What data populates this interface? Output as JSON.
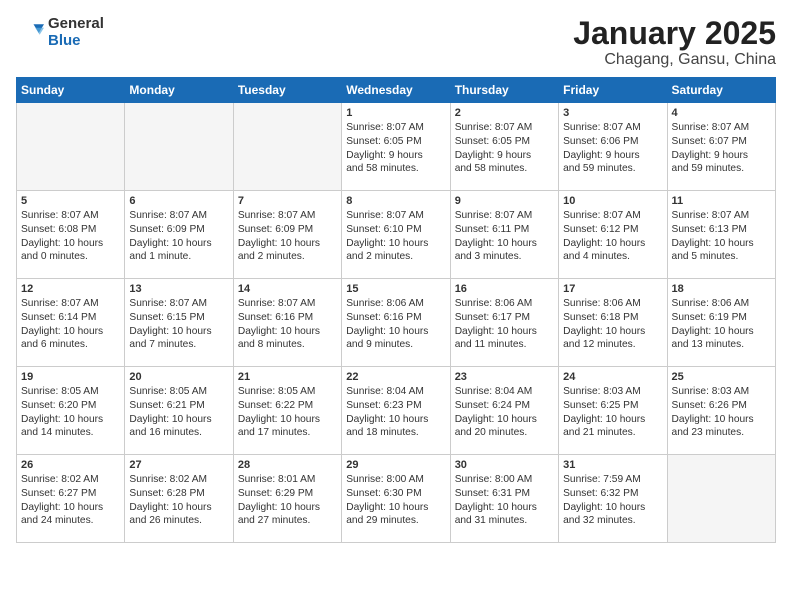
{
  "header": {
    "logo_general": "General",
    "logo_blue": "Blue",
    "title": "January 2025",
    "subtitle": "Chagang, Gansu, China"
  },
  "weekdays": [
    "Sunday",
    "Monday",
    "Tuesday",
    "Wednesday",
    "Thursday",
    "Friday",
    "Saturday"
  ],
  "weeks": [
    [
      {
        "day": "",
        "info": ""
      },
      {
        "day": "",
        "info": ""
      },
      {
        "day": "",
        "info": ""
      },
      {
        "day": "1",
        "info": "Sunrise: 8:07 AM\nSunset: 6:05 PM\nDaylight: 9 hours\nand 58 minutes."
      },
      {
        "day": "2",
        "info": "Sunrise: 8:07 AM\nSunset: 6:05 PM\nDaylight: 9 hours\nand 58 minutes."
      },
      {
        "day": "3",
        "info": "Sunrise: 8:07 AM\nSunset: 6:06 PM\nDaylight: 9 hours\nand 59 minutes."
      },
      {
        "day": "4",
        "info": "Sunrise: 8:07 AM\nSunset: 6:07 PM\nDaylight: 9 hours\nand 59 minutes."
      }
    ],
    [
      {
        "day": "5",
        "info": "Sunrise: 8:07 AM\nSunset: 6:08 PM\nDaylight: 10 hours\nand 0 minutes."
      },
      {
        "day": "6",
        "info": "Sunrise: 8:07 AM\nSunset: 6:09 PM\nDaylight: 10 hours\nand 1 minute."
      },
      {
        "day": "7",
        "info": "Sunrise: 8:07 AM\nSunset: 6:09 PM\nDaylight: 10 hours\nand 2 minutes."
      },
      {
        "day": "8",
        "info": "Sunrise: 8:07 AM\nSunset: 6:10 PM\nDaylight: 10 hours\nand 2 minutes."
      },
      {
        "day": "9",
        "info": "Sunrise: 8:07 AM\nSunset: 6:11 PM\nDaylight: 10 hours\nand 3 minutes."
      },
      {
        "day": "10",
        "info": "Sunrise: 8:07 AM\nSunset: 6:12 PM\nDaylight: 10 hours\nand 4 minutes."
      },
      {
        "day": "11",
        "info": "Sunrise: 8:07 AM\nSunset: 6:13 PM\nDaylight: 10 hours\nand 5 minutes."
      }
    ],
    [
      {
        "day": "12",
        "info": "Sunrise: 8:07 AM\nSunset: 6:14 PM\nDaylight: 10 hours\nand 6 minutes."
      },
      {
        "day": "13",
        "info": "Sunrise: 8:07 AM\nSunset: 6:15 PM\nDaylight: 10 hours\nand 7 minutes."
      },
      {
        "day": "14",
        "info": "Sunrise: 8:07 AM\nSunset: 6:16 PM\nDaylight: 10 hours\nand 8 minutes."
      },
      {
        "day": "15",
        "info": "Sunrise: 8:06 AM\nSunset: 6:16 PM\nDaylight: 10 hours\nand 9 minutes."
      },
      {
        "day": "16",
        "info": "Sunrise: 8:06 AM\nSunset: 6:17 PM\nDaylight: 10 hours\nand 11 minutes."
      },
      {
        "day": "17",
        "info": "Sunrise: 8:06 AM\nSunset: 6:18 PM\nDaylight: 10 hours\nand 12 minutes."
      },
      {
        "day": "18",
        "info": "Sunrise: 8:06 AM\nSunset: 6:19 PM\nDaylight: 10 hours\nand 13 minutes."
      }
    ],
    [
      {
        "day": "19",
        "info": "Sunrise: 8:05 AM\nSunset: 6:20 PM\nDaylight: 10 hours\nand 14 minutes."
      },
      {
        "day": "20",
        "info": "Sunrise: 8:05 AM\nSunset: 6:21 PM\nDaylight: 10 hours\nand 16 minutes."
      },
      {
        "day": "21",
        "info": "Sunrise: 8:05 AM\nSunset: 6:22 PM\nDaylight: 10 hours\nand 17 minutes."
      },
      {
        "day": "22",
        "info": "Sunrise: 8:04 AM\nSunset: 6:23 PM\nDaylight: 10 hours\nand 18 minutes."
      },
      {
        "day": "23",
        "info": "Sunrise: 8:04 AM\nSunset: 6:24 PM\nDaylight: 10 hours\nand 20 minutes."
      },
      {
        "day": "24",
        "info": "Sunrise: 8:03 AM\nSunset: 6:25 PM\nDaylight: 10 hours\nand 21 minutes."
      },
      {
        "day": "25",
        "info": "Sunrise: 8:03 AM\nSunset: 6:26 PM\nDaylight: 10 hours\nand 23 minutes."
      }
    ],
    [
      {
        "day": "26",
        "info": "Sunrise: 8:02 AM\nSunset: 6:27 PM\nDaylight: 10 hours\nand 24 minutes."
      },
      {
        "day": "27",
        "info": "Sunrise: 8:02 AM\nSunset: 6:28 PM\nDaylight: 10 hours\nand 26 minutes."
      },
      {
        "day": "28",
        "info": "Sunrise: 8:01 AM\nSunset: 6:29 PM\nDaylight: 10 hours\nand 27 minutes."
      },
      {
        "day": "29",
        "info": "Sunrise: 8:00 AM\nSunset: 6:30 PM\nDaylight: 10 hours\nand 29 minutes."
      },
      {
        "day": "30",
        "info": "Sunrise: 8:00 AM\nSunset: 6:31 PM\nDaylight: 10 hours\nand 31 minutes."
      },
      {
        "day": "31",
        "info": "Sunrise: 7:59 AM\nSunset: 6:32 PM\nDaylight: 10 hours\nand 32 minutes."
      },
      {
        "day": "",
        "info": ""
      }
    ]
  ]
}
